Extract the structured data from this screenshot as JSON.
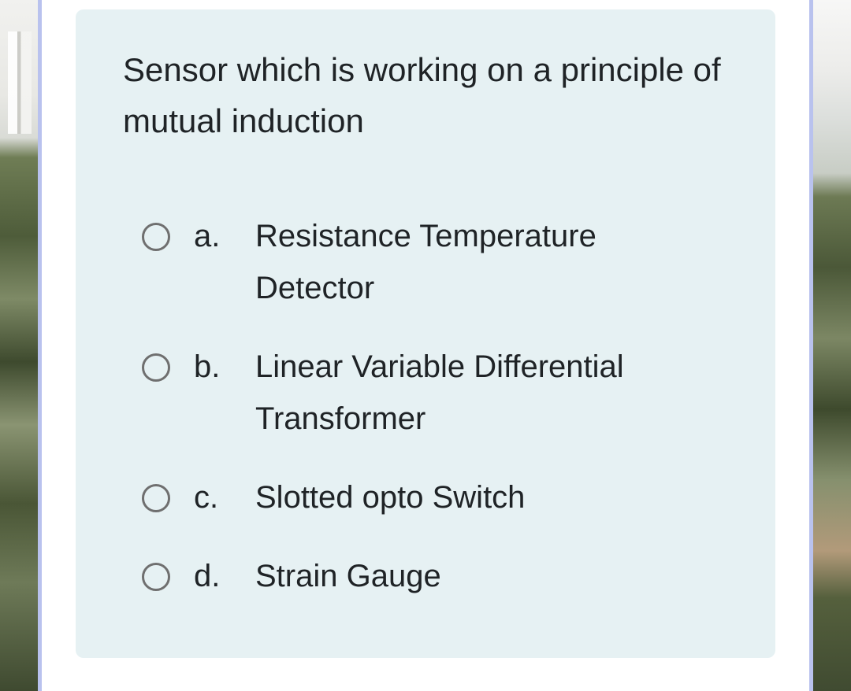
{
  "question": {
    "text": "Sensor which is working on a principle of mutual induction"
  },
  "options": [
    {
      "letter": "a.",
      "text": "Resistance Temperature Detector",
      "selected": false
    },
    {
      "letter": "b.",
      "text": "Linear Variable Differential Transformer",
      "selected": false
    },
    {
      "letter": "c.",
      "text": "Slotted opto Switch",
      "selected": false
    },
    {
      "letter": "d.",
      "text": "Strain Gauge",
      "selected": false
    }
  ],
  "colors": {
    "card_background": "#e6f1f3",
    "text": "#1f2326",
    "radio_border": "#6f6f6f",
    "frame_border": "#b9c2ee"
  },
  "icons": {
    "radio": "radio-unchecked-icon"
  }
}
